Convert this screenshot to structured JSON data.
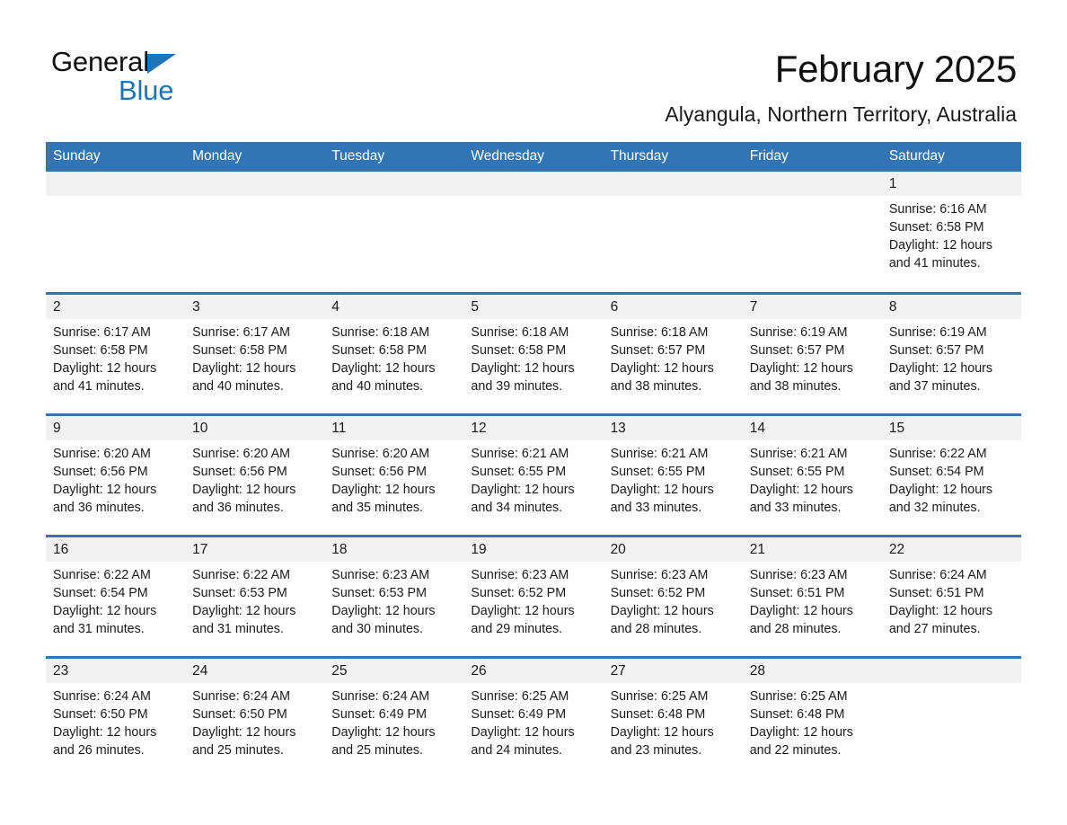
{
  "brand": {
    "name_part1": "General",
    "name_part2": "Blue",
    "accent_color": "#1b75bb",
    "logo_icon": "triangle-flag-icon"
  },
  "header": {
    "title": "February 2025",
    "subtitle": "Alyangula, Northern Territory, Australia"
  },
  "calendar": {
    "header_bg": "#3275b6",
    "daynum_bg": "#f1f1f1",
    "weekday_headers": [
      "Sunday",
      "Monday",
      "Tuesday",
      "Wednesday",
      "Thursday",
      "Friday",
      "Saturday"
    ],
    "weeks": [
      [
        {
          "day": "",
          "lines": []
        },
        {
          "day": "",
          "lines": []
        },
        {
          "day": "",
          "lines": []
        },
        {
          "day": "",
          "lines": []
        },
        {
          "day": "",
          "lines": []
        },
        {
          "day": "",
          "lines": []
        },
        {
          "day": "1",
          "lines": [
            "Sunrise: 6:16 AM",
            "Sunset: 6:58 PM",
            "Daylight: 12 hours",
            "and 41 minutes."
          ]
        }
      ],
      [
        {
          "day": "2",
          "lines": [
            "Sunrise: 6:17 AM",
            "Sunset: 6:58 PM",
            "Daylight: 12 hours",
            "and 41 minutes."
          ]
        },
        {
          "day": "3",
          "lines": [
            "Sunrise: 6:17 AM",
            "Sunset: 6:58 PM",
            "Daylight: 12 hours",
            "and 40 minutes."
          ]
        },
        {
          "day": "4",
          "lines": [
            "Sunrise: 6:18 AM",
            "Sunset: 6:58 PM",
            "Daylight: 12 hours",
            "and 40 minutes."
          ]
        },
        {
          "day": "5",
          "lines": [
            "Sunrise: 6:18 AM",
            "Sunset: 6:58 PM",
            "Daylight: 12 hours",
            "and 39 minutes."
          ]
        },
        {
          "day": "6",
          "lines": [
            "Sunrise: 6:18 AM",
            "Sunset: 6:57 PM",
            "Daylight: 12 hours",
            "and 38 minutes."
          ]
        },
        {
          "day": "7",
          "lines": [
            "Sunrise: 6:19 AM",
            "Sunset: 6:57 PM",
            "Daylight: 12 hours",
            "and 38 minutes."
          ]
        },
        {
          "day": "8",
          "lines": [
            "Sunrise: 6:19 AM",
            "Sunset: 6:57 PM",
            "Daylight: 12 hours",
            "and 37 minutes."
          ]
        }
      ],
      [
        {
          "day": "9",
          "lines": [
            "Sunrise: 6:20 AM",
            "Sunset: 6:56 PM",
            "Daylight: 12 hours",
            "and 36 minutes."
          ]
        },
        {
          "day": "10",
          "lines": [
            "Sunrise: 6:20 AM",
            "Sunset: 6:56 PM",
            "Daylight: 12 hours",
            "and 36 minutes."
          ]
        },
        {
          "day": "11",
          "lines": [
            "Sunrise: 6:20 AM",
            "Sunset: 6:56 PM",
            "Daylight: 12 hours",
            "and 35 minutes."
          ]
        },
        {
          "day": "12",
          "lines": [
            "Sunrise: 6:21 AM",
            "Sunset: 6:55 PM",
            "Daylight: 12 hours",
            "and 34 minutes."
          ]
        },
        {
          "day": "13",
          "lines": [
            "Sunrise: 6:21 AM",
            "Sunset: 6:55 PM",
            "Daylight: 12 hours",
            "and 33 minutes."
          ]
        },
        {
          "day": "14",
          "lines": [
            "Sunrise: 6:21 AM",
            "Sunset: 6:55 PM",
            "Daylight: 12 hours",
            "and 33 minutes."
          ]
        },
        {
          "day": "15",
          "lines": [
            "Sunrise: 6:22 AM",
            "Sunset: 6:54 PM",
            "Daylight: 12 hours",
            "and 32 minutes."
          ]
        }
      ],
      [
        {
          "day": "16",
          "lines": [
            "Sunrise: 6:22 AM",
            "Sunset: 6:54 PM",
            "Daylight: 12 hours",
            "and 31 minutes."
          ]
        },
        {
          "day": "17",
          "lines": [
            "Sunrise: 6:22 AM",
            "Sunset: 6:53 PM",
            "Daylight: 12 hours",
            "and 31 minutes."
          ]
        },
        {
          "day": "18",
          "lines": [
            "Sunrise: 6:23 AM",
            "Sunset: 6:53 PM",
            "Daylight: 12 hours",
            "and 30 minutes."
          ]
        },
        {
          "day": "19",
          "lines": [
            "Sunrise: 6:23 AM",
            "Sunset: 6:52 PM",
            "Daylight: 12 hours",
            "and 29 minutes."
          ]
        },
        {
          "day": "20",
          "lines": [
            "Sunrise: 6:23 AM",
            "Sunset: 6:52 PM",
            "Daylight: 12 hours",
            "and 28 minutes."
          ]
        },
        {
          "day": "21",
          "lines": [
            "Sunrise: 6:23 AM",
            "Sunset: 6:51 PM",
            "Daylight: 12 hours",
            "and 28 minutes."
          ]
        },
        {
          "day": "22",
          "lines": [
            "Sunrise: 6:24 AM",
            "Sunset: 6:51 PM",
            "Daylight: 12 hours",
            "and 27 minutes."
          ]
        }
      ],
      [
        {
          "day": "23",
          "lines": [
            "Sunrise: 6:24 AM",
            "Sunset: 6:50 PM",
            "Daylight: 12 hours",
            "and 26 minutes."
          ]
        },
        {
          "day": "24",
          "lines": [
            "Sunrise: 6:24 AM",
            "Sunset: 6:50 PM",
            "Daylight: 12 hours",
            "and 25 minutes."
          ]
        },
        {
          "day": "25",
          "lines": [
            "Sunrise: 6:24 AM",
            "Sunset: 6:49 PM",
            "Daylight: 12 hours",
            "and 25 minutes."
          ]
        },
        {
          "day": "26",
          "lines": [
            "Sunrise: 6:25 AM",
            "Sunset: 6:49 PM",
            "Daylight: 12 hours",
            "and 24 minutes."
          ]
        },
        {
          "day": "27",
          "lines": [
            "Sunrise: 6:25 AM",
            "Sunset: 6:48 PM",
            "Daylight: 12 hours",
            "and 23 minutes."
          ]
        },
        {
          "day": "28",
          "lines": [
            "Sunrise: 6:25 AM",
            "Sunset: 6:48 PM",
            "Daylight: 12 hours",
            "and 22 minutes."
          ]
        },
        {
          "day": "",
          "lines": []
        }
      ]
    ]
  }
}
